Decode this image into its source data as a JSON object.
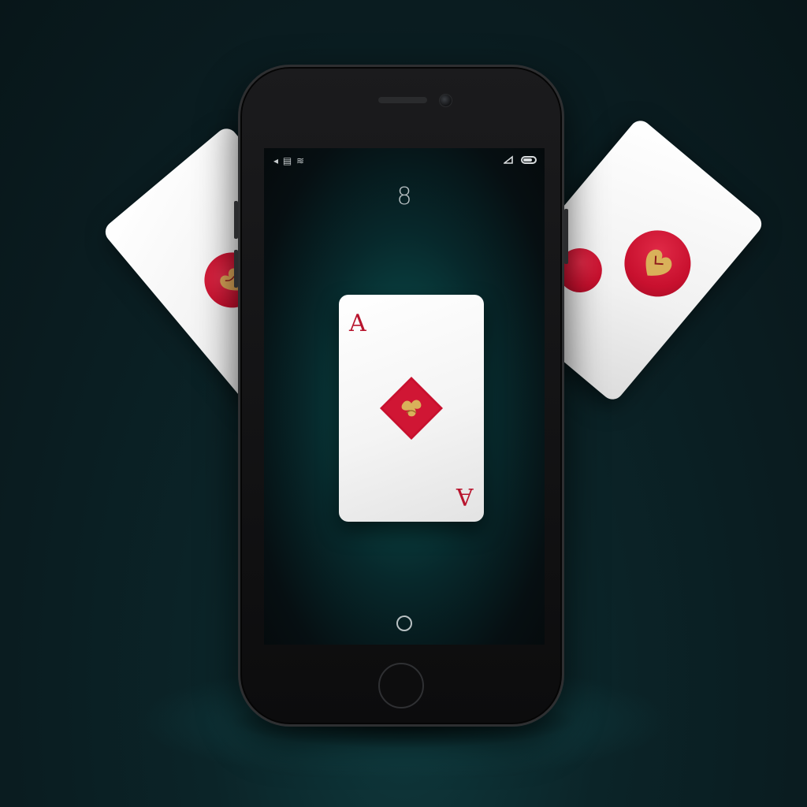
{
  "scene": {
    "background_color": "#0a1c20",
    "accent_color": "#0f6060",
    "suit_color": "#c8102e",
    "gold_color": "#c9a24a"
  },
  "status_bar": {
    "left_text": "◂ ▤ ≋",
    "right_icons": [
      "signal-icon",
      "battery-icon"
    ],
    "battery_level": 0.75
  },
  "screen": {
    "counter": "8"
  },
  "main_card": {
    "rank": "A",
    "suit": "diamond"
  },
  "side_cards": [
    {
      "position": "left",
      "suit": "heart"
    },
    {
      "position": "right",
      "suit": "heart"
    }
  ],
  "icons": {
    "home_indicator": "circle-icon"
  }
}
